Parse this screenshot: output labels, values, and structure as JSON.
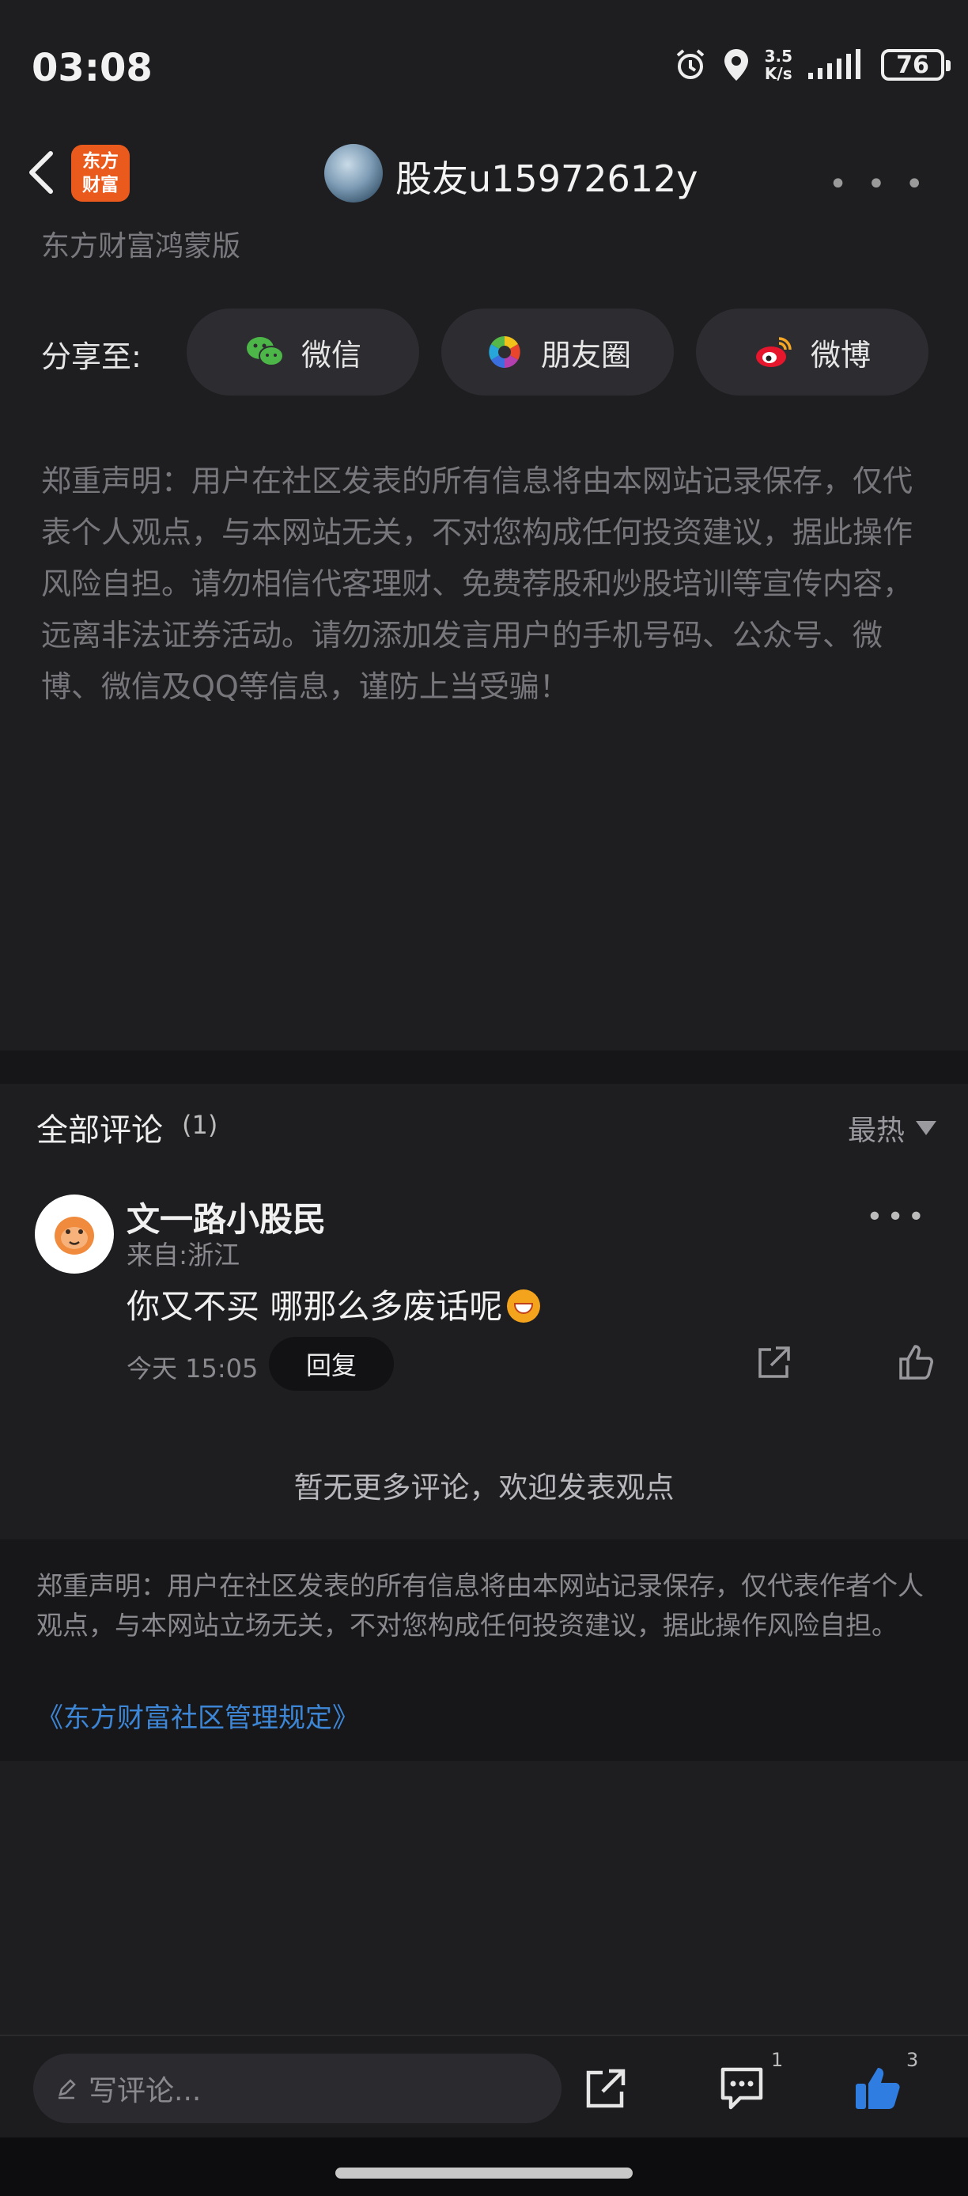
{
  "status_bar": {
    "time": "03:08",
    "net_speed_value": "3.5",
    "net_speed_unit": "K/s",
    "battery": "76"
  },
  "header": {
    "logo_line1": "东方",
    "logo_line2": "财富",
    "title": "股友u15972612y",
    "more": "• • •"
  },
  "app_version": "东方财富鸿蒙版",
  "share": {
    "label": "分享至:",
    "wechat": "微信",
    "moments": "朋友圈",
    "weibo": "微博"
  },
  "disclaimer_top": "郑重声明：用户在社区发表的所有信息将由本网站记录保存，仅代表个人观点，与本网站无关，不对您构成任何投资建议，据此操作风险自担。请勿相信代客理财、免费荐股和炒股培训等宣传内容，远离非法证券活动。请勿添加发言用户的手机号码、公众号、微博、微信及QQ等信息，谨防上当受骗！",
  "comments": {
    "title": "全部评论",
    "count": "(1)",
    "sort_label": "最热",
    "items": [
      {
        "user": "文一路小股民",
        "location": "来自:浙江",
        "text": "你又不买 哪那么多废话呢",
        "time": "今天 15:05",
        "reply_label": "回复"
      }
    ],
    "no_more": "暂无更多评论，欢迎发表观点"
  },
  "footer": {
    "disclaimer": "郑重声明：用户在社区发表的所有信息将由本网站记录保存，仅代表作者个人观点，与本网站立场无关，不对您构成任何投资建议，据此操作风险自担。",
    "rules_link": "《东方财富社区管理规定》"
  },
  "bottom_bar": {
    "input_placeholder": "写评论...",
    "comment_count": "1",
    "like_count": "3"
  },
  "colors": {
    "background": "#1e1e21",
    "logo": "#ea5a1d",
    "link": "#3d86d6",
    "like_active": "#2f7de1"
  }
}
